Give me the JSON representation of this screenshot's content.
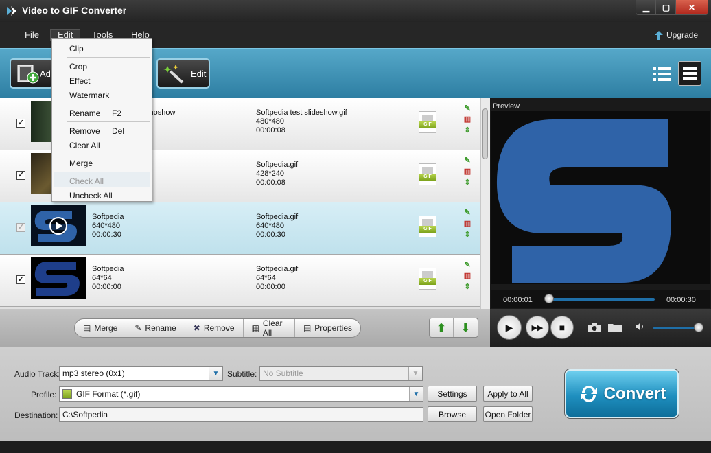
{
  "window": {
    "title": "Video to GIF Converter",
    "min_icon": "minimize-icon",
    "max_icon": "maximize-icon",
    "close_icon": "close-icon"
  },
  "menubar": {
    "items": [
      "File",
      "Edit",
      "Tools",
      "Help"
    ],
    "upgrade": "Upgrade"
  },
  "toolbar": {
    "add_label": "Ad",
    "edit_label": "Edit"
  },
  "edit_menu": {
    "items": [
      {
        "label": "Clip"
      },
      {
        "label": "Crop"
      },
      {
        "label": "Effect"
      },
      {
        "label": "Watermark"
      },
      {
        "label": "Rename",
        "shortcut": "F2"
      },
      {
        "label": "Remove",
        "shortcut": "Del"
      },
      {
        "label": "Clear All"
      },
      {
        "label": "Merge"
      },
      {
        "label": "Check All",
        "disabled": true
      },
      {
        "label": "Uncheck All"
      }
    ]
  },
  "files": [
    {
      "checked": true,
      "src_name": "shoshow",
      "src_res": "",
      "src_dur": "",
      "out_name": "Softpedia test slideshow.gif",
      "out_res": "480*480",
      "out_dur": "00:00:08"
    },
    {
      "checked": true,
      "src_name": "",
      "src_res": "",
      "src_dur": "",
      "out_name": "Softpedia.gif",
      "out_res": "428*240",
      "out_dur": "00:00:08"
    },
    {
      "checked": true,
      "selected": true,
      "src_name": "Softpedia",
      "src_res": "640*480",
      "src_dur": "00:00:30",
      "out_name": "Softpedia.gif",
      "out_res": "640*480",
      "out_dur": "00:00:30"
    },
    {
      "checked": true,
      "src_name": "Softpedia",
      "src_res": "64*64",
      "src_dur": "00:00:00",
      "out_name": "Softpedia.gif",
      "out_res": "64*64",
      "out_dur": "00:00:00"
    }
  ],
  "gif_badge": "GIF",
  "list_buttons": {
    "merge": "Merge",
    "rename": "Rename",
    "remove": "Remove",
    "clear_all": "Clear All",
    "properties": "Properties"
  },
  "preview": {
    "label": "Preview",
    "current_time": "00:00:01",
    "end_time": "00:00:30",
    "progress": 0.03,
    "volume": 0.9
  },
  "settings": {
    "audio_track_label": "Audio Track:",
    "audio_track_value": "mp3 stereo (0x1)",
    "subtitle_label": "Subtitle:",
    "subtitle_placeholder": "No Subtitle",
    "profile_label": "Profile:",
    "profile_value": "GIF Format (*.gif)",
    "destination_label": "Destination:",
    "destination_value": "C:\\Softpedia",
    "settings_btn": "Settings",
    "apply_all_btn": "Apply to All",
    "browse_btn": "Browse",
    "open_folder_btn": "Open Folder",
    "convert_btn": "Convert"
  },
  "colors": {
    "accent": "#2d7ea2",
    "progress": "#1f6fa8",
    "preview_logo": "#2f63a8"
  }
}
